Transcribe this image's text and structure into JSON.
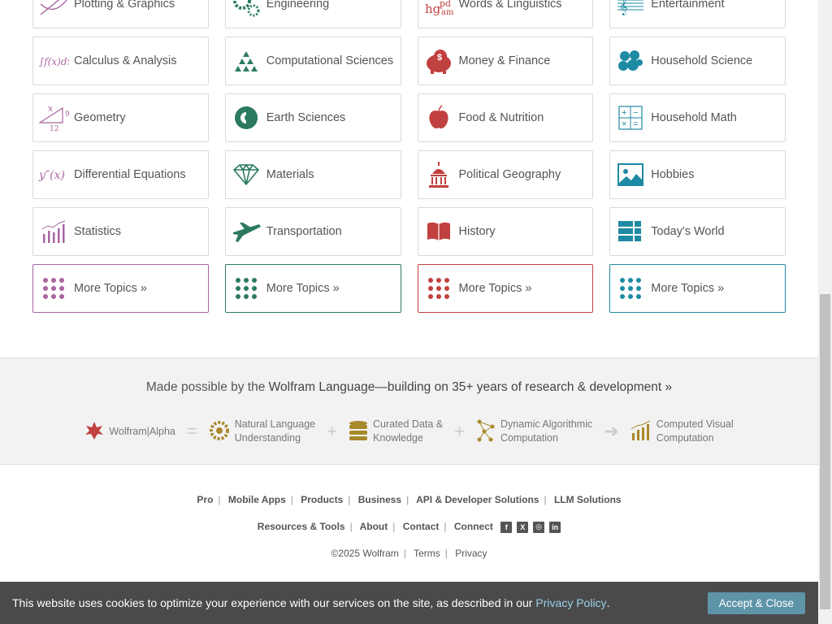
{
  "topics": [
    [
      "Plotting & Graphics",
      "Engineering",
      "Words & Linguistics",
      "Entertainment"
    ],
    [
      "Calculus & Analysis",
      "Computational Sciences",
      "Money & Finance",
      "Household Science"
    ],
    [
      "Geometry",
      "Earth Sciences",
      "Food & Nutrition",
      "Household Math"
    ],
    [
      "Differential Equations",
      "Materials",
      "Political Geography",
      "Hobbies"
    ],
    [
      "Statistics",
      "Transportation",
      "History",
      "Today's World"
    ]
  ],
  "more_topics_label": "More Topics »",
  "colors": {
    "math": "#a8659f",
    "science": "#2b7a61",
    "society": "#c0413f",
    "everyday": "#1e8aa3"
  },
  "band": {
    "made_prefix": "Made possible by the",
    "made_link": "Wolfram Language—building on 35+ years of research & development »",
    "wa": "Wolfram|Alpha",
    "nlu": [
      "Natural Language",
      "Understanding"
    ],
    "curated": [
      "Curated Data &",
      "Knowledge"
    ],
    "dynamic": [
      "Dynamic Algorithmic",
      "Computation"
    ],
    "visual": [
      "Computed Visual",
      "Computation"
    ]
  },
  "footer": {
    "row1": [
      "Pro",
      "Mobile Apps",
      "Products",
      "Business",
      "API & Developer Solutions",
      "LLM Solutions"
    ],
    "row2": [
      "Resources & Tools",
      "About",
      "Contact",
      "Connect"
    ],
    "copyright": "©2025  Wolfram",
    "terms": "Terms",
    "privacy": "Privacy"
  },
  "cookie": {
    "text": "This website uses cookies to optimize your experience with our services on the site, as described in our",
    "link": "Privacy Policy",
    "accept": "Accept & Close"
  }
}
